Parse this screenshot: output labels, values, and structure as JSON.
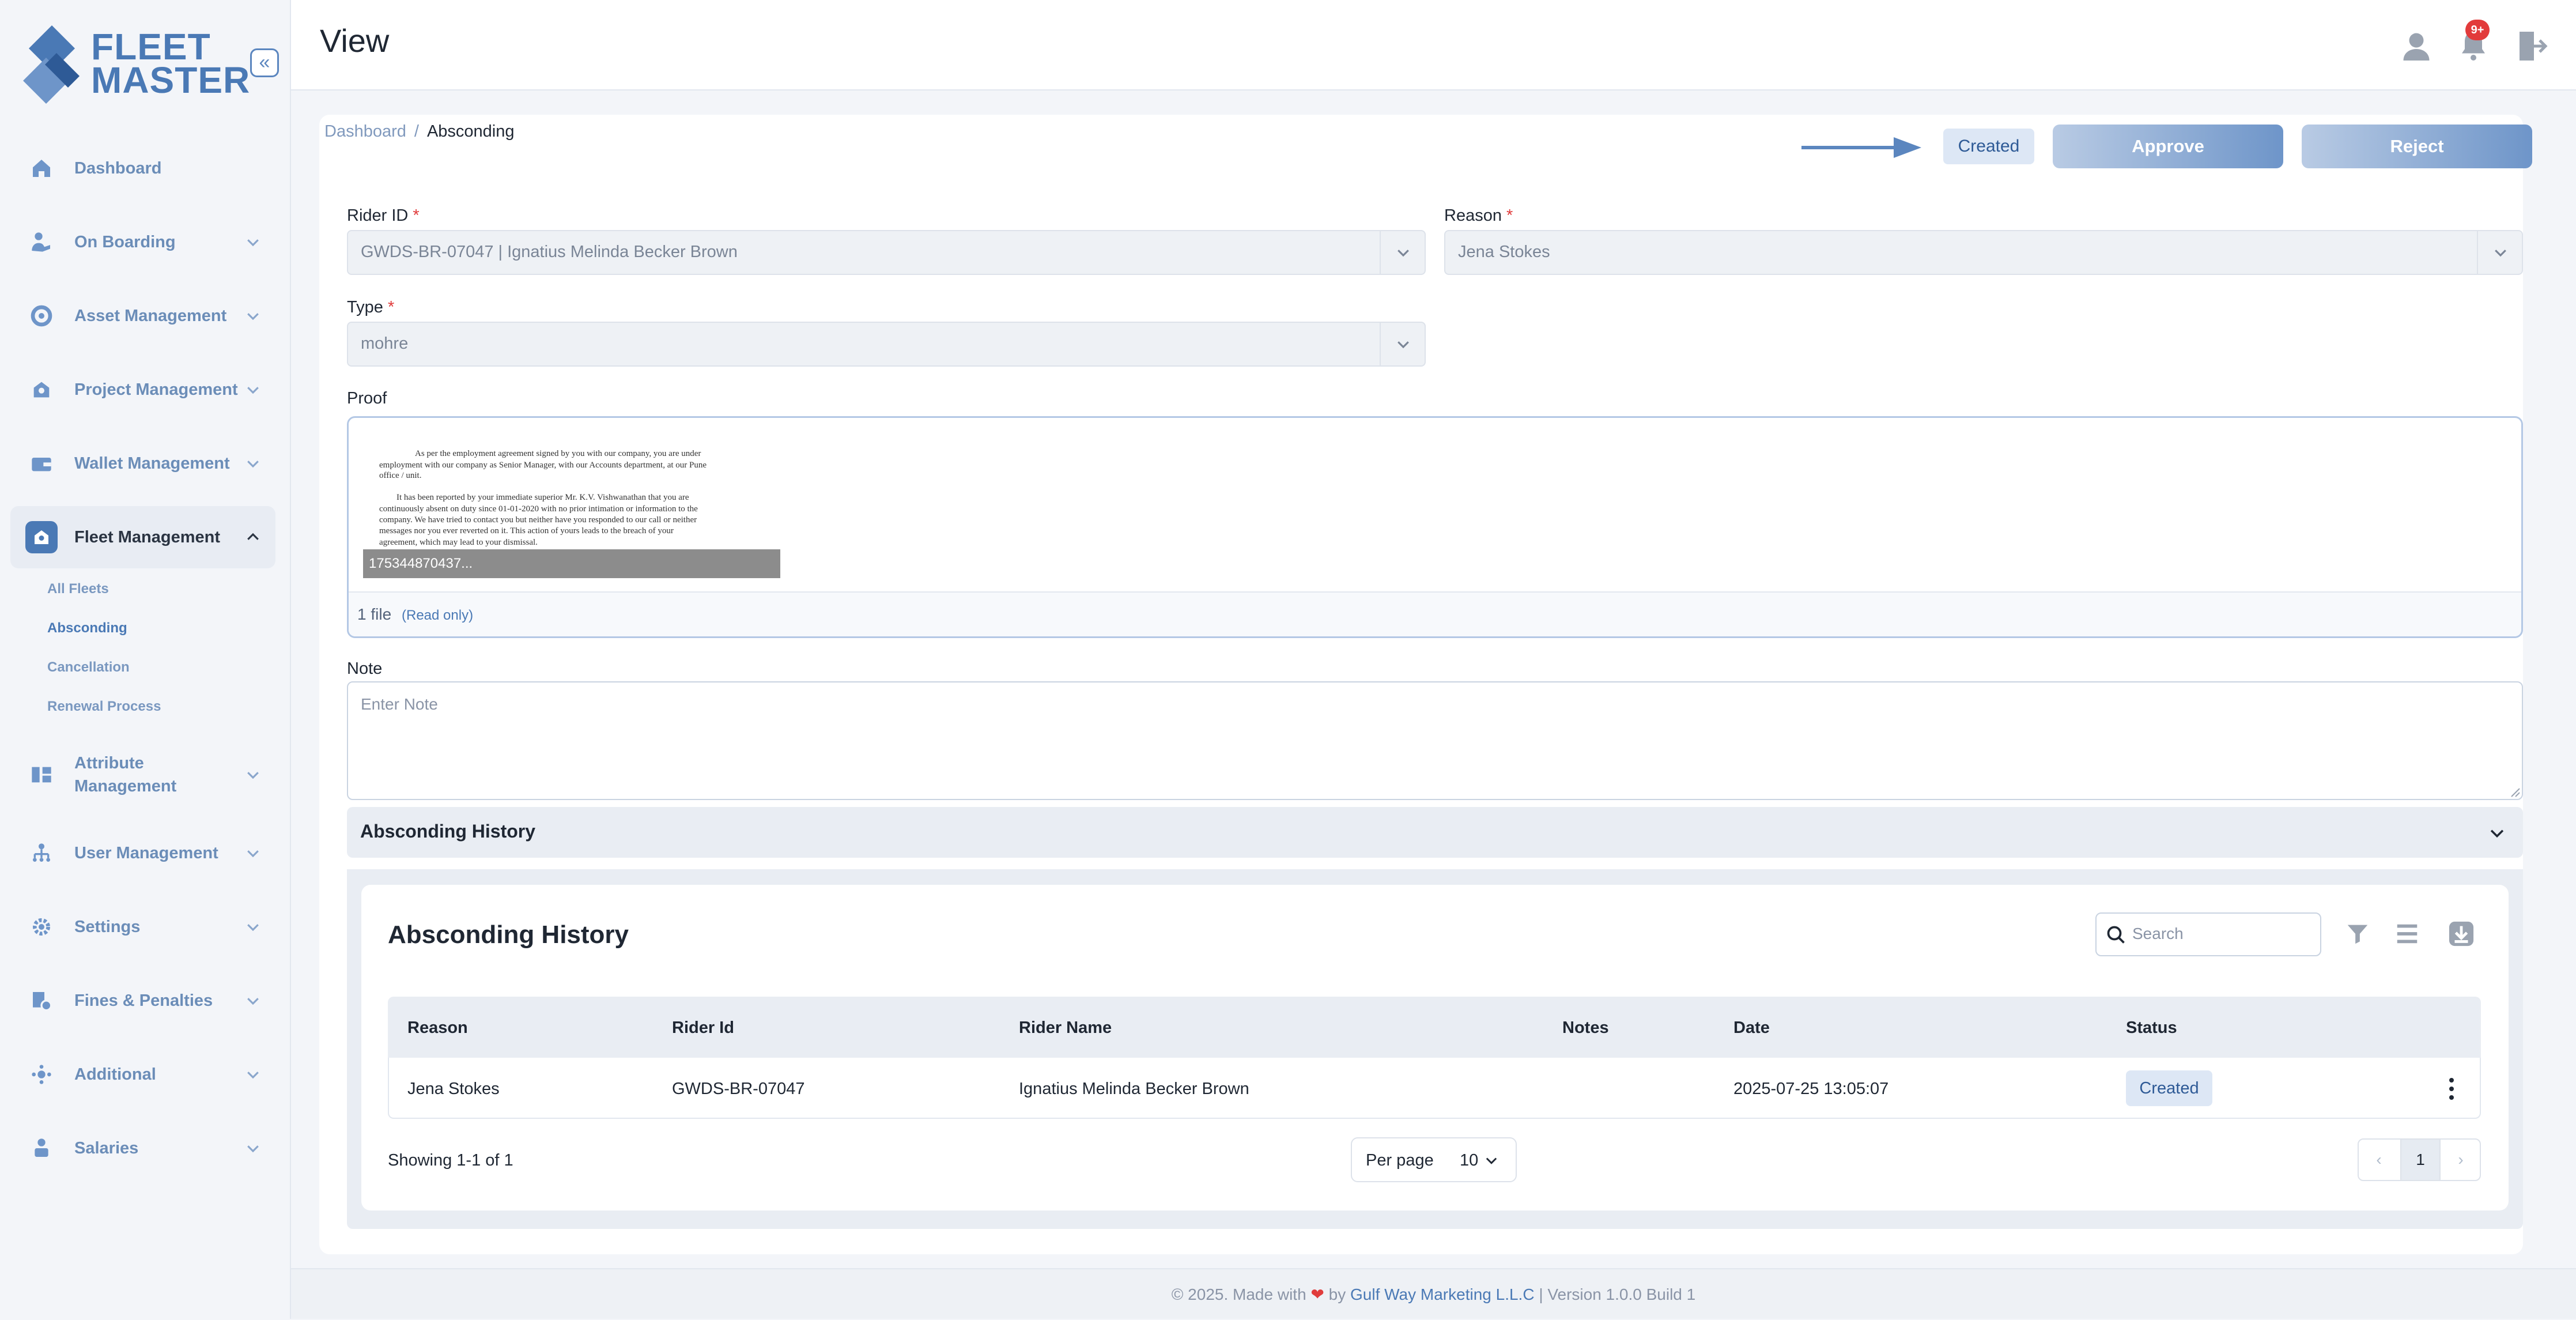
{
  "app": {
    "logo_line1": "FLEET",
    "logo_line2": "MASTER",
    "collapse_glyph": "«"
  },
  "sidebar": {
    "items": [
      {
        "label": "Dashboard",
        "icon": "home-icon"
      },
      {
        "label": "On Boarding",
        "icon": "onboarding-icon"
      },
      {
        "label": "Asset Management",
        "icon": "asset-icon"
      },
      {
        "label": "Project Management",
        "icon": "project-icon"
      },
      {
        "label": "Wallet Management",
        "icon": "wallet-icon"
      },
      {
        "label": "Fleet Management",
        "icon": "fleet-icon"
      },
      {
        "label": "Attribute Management",
        "icon": "attribute-icon"
      },
      {
        "label": "User Management",
        "icon": "user-hierarchy-icon"
      },
      {
        "label": "Settings",
        "icon": "gear-icon"
      },
      {
        "label": "Fines & Penalties",
        "icon": "fines-icon"
      },
      {
        "label": "Additional",
        "icon": "additional-icon"
      },
      {
        "label": "Salaries",
        "icon": "salaries-icon"
      }
    ],
    "fleet_sub": [
      "All Fleets",
      "Absconding",
      "Cancellation",
      "Renewal Process"
    ]
  },
  "header": {
    "title": "View",
    "notif_badge": "9+"
  },
  "breadcrumb": {
    "root": "Dashboard",
    "separator": "/",
    "current": "Absconding"
  },
  "actions": {
    "status": "Created",
    "approve": "Approve",
    "reject": "Reject"
  },
  "form": {
    "rider_label": "Rider ID",
    "rider_value": "GWDS-BR-07047 | Ignatius Melinda Becker Brown",
    "reason_label": "Reason",
    "reason_value": "Jena Stokes",
    "type_label": "Type",
    "type_value": "mohre",
    "required_mark": "*",
    "proof_label": "Proof",
    "proof_filename": "175344870437...",
    "proof_count": "1 file",
    "proof_readonly": "(Read only)",
    "note_label": "Note",
    "note_placeholder": "Enter Note"
  },
  "document_preview": {
    "lines": [
      "As per the employment agreement signed by you with our company, you are under",
      "employment with our company as Senior Manager, with our Accounts department, at our Pune",
      "office / unit.",
      "It has been reported by your immediate superior Mr. K.V. Vishwanathan that you are",
      "continuously absent on duty since 01-01-2020 with no prior intimation or information to the",
      "company. We have tried to contact you but neither have you responded to our call or neither",
      "messages nor you ever reverted on it. This action of yours leads to the breach of your",
      "agreement, which may lead to your dismissal."
    ]
  },
  "history": {
    "accordion_title": "Absconding History",
    "title": "Absconding History",
    "search_placeholder": "Search",
    "columns": [
      "Reason",
      "Rider Id",
      "Rider Name",
      "Notes",
      "Date",
      "Status"
    ],
    "rows": [
      {
        "reason": "Jena Stokes",
        "rider_id": "GWDS-BR-07047",
        "rider_name": "Ignatius Melinda Becker Brown",
        "notes": "",
        "date": "2025-07-25 13:05:07",
        "status": "Created"
      }
    ],
    "showing": "Showing 1-1 of 1",
    "per_page_label": "Per page",
    "per_page_value": "10",
    "page": "1"
  },
  "footer": {
    "prefix": "© 2025. Made with",
    "by": "by",
    "company": "Gulf Way Marketing L.L.C",
    "version": "| Version 1.0.0 Build 1"
  },
  "colors": {
    "accent": "#4a79b5",
    "danger": "#e03c3c",
    "status_bg": "#dde7f5"
  }
}
